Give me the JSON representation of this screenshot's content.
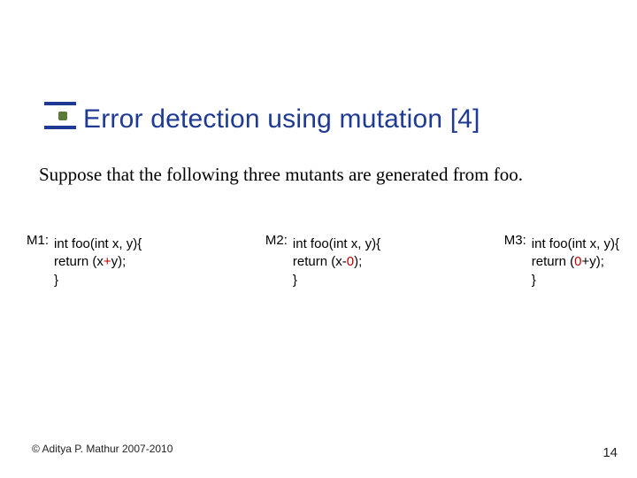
{
  "title": "Error detection using mutation [4]",
  "body": "Suppose that the following three mutants are generated from foo.",
  "mutants": [
    {
      "label": "M1:",
      "line1": "int foo(int x, y){",
      "line2_pre": "return (x",
      "line2_hl": "+",
      "line2_post": "y);",
      "line3": "}"
    },
    {
      "label": "M2:",
      "line1": "int foo(int x, y){",
      "line2_pre": "return (x-",
      "line2_hl": "0",
      "line2_post": ");",
      "line3": "}"
    },
    {
      "label": "M3:",
      "line1": "int foo(int x, y){",
      "line2_pre": "return (",
      "line2_hl": "0",
      "line2_post": "+y);",
      "line3": "}"
    }
  ],
  "footer": {
    "copyright": "© Aditya P. Mathur 2007-2010",
    "page": "14"
  }
}
